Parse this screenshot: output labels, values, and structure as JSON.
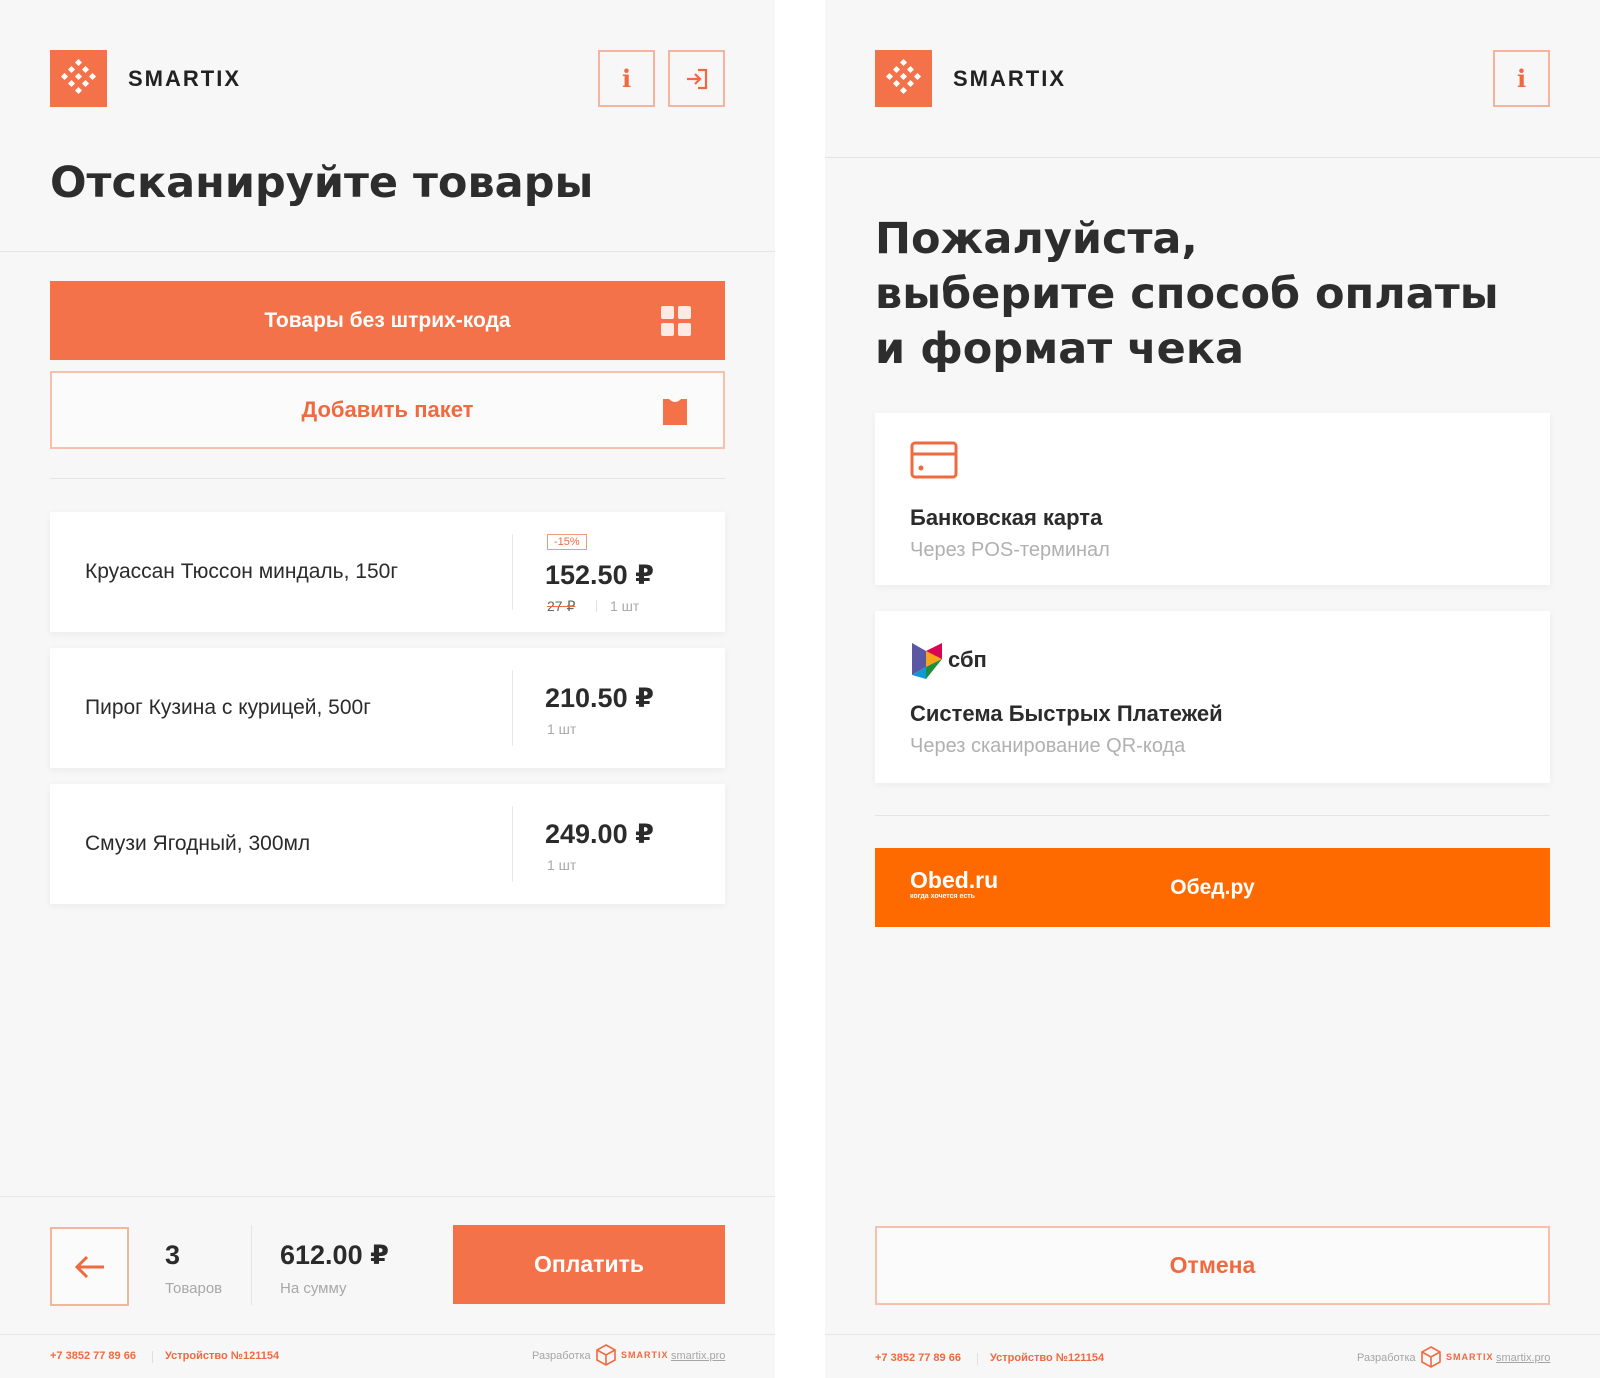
{
  "brand": {
    "name": "SMARTIX",
    "accent": "#f47249",
    "obed_orange": "#ff6a00"
  },
  "left": {
    "icons": {
      "info": "i"
    },
    "title": "Отсканируйте товары",
    "no_barcode_label": "Товары без штрих-кода",
    "add_bag_label": "Добавить пакет",
    "items": [
      {
        "name": "Круассан Тюссон миндаль, 150г",
        "price": "152.50 ₽",
        "discount": "-15%",
        "old_price": "27 ₽",
        "qty": "1 шт"
      },
      {
        "name": "Пирог Кузина с курицей, 500г",
        "price": "210.50 ₽",
        "qty": "1 шт"
      },
      {
        "name": "Смузи Ягодный, 300мл",
        "price": "249.00 ₽",
        "qty": "1 шт"
      }
    ],
    "bottom": {
      "count": "3",
      "count_label": "Товаров",
      "total": "612.00 ₽",
      "total_label": "На сумму",
      "pay_label": "Оплатить"
    }
  },
  "right": {
    "icons": {
      "info": "i"
    },
    "title_lines": [
      "Пожалуйста,",
      "выберите способ оплаты",
      "и формат чека"
    ],
    "payment_methods": [
      {
        "title": "Банковская карта",
        "subtitle": "Через POS-терминал"
      },
      {
        "title": "Система Быстрых Платежей",
        "subtitle": "Через сканирование QR-кода",
        "logo_text": "сбп"
      }
    ],
    "obed": {
      "logo": "Obed.ru",
      "tagline": "когда хочется есть",
      "label": "Обед.ру"
    },
    "cancel_label": "Отмена"
  },
  "footer": {
    "phone": "+7 3852 77 89 66",
    "device": "Устройство №121154",
    "dev_label": "Разработка",
    "brand": "SMARTIX",
    "site": "smartix.pro"
  }
}
